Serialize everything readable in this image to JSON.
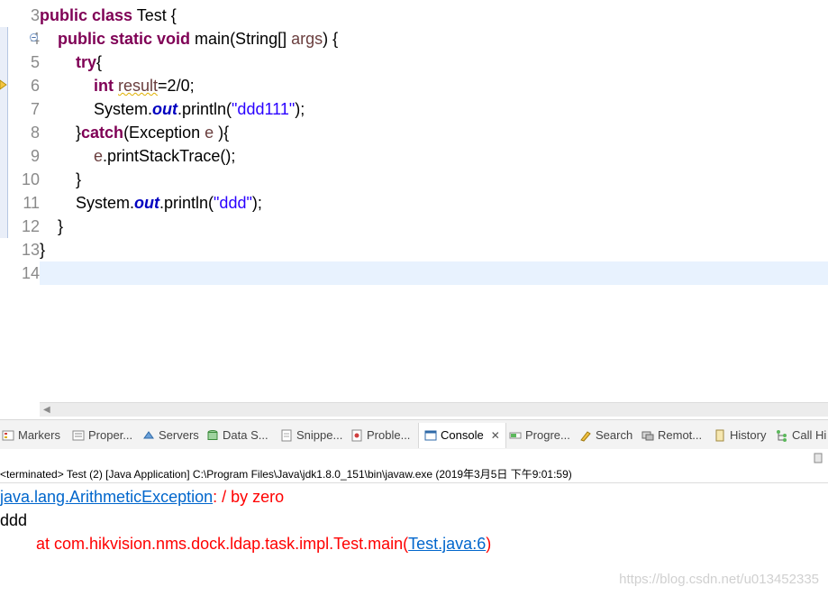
{
  "editor": {
    "line_numbers": [
      "3",
      "4",
      "5",
      "6",
      "7",
      "8",
      "9",
      "10",
      "11",
      "12",
      "13",
      "14"
    ],
    "lines": {
      "l3": {
        "kw1": "public class",
        "rest": " Test {"
      },
      "l4": {
        "indent": "    ",
        "kw1": "public static void",
        "m": " main(String[] ",
        "param": "args",
        "rest": ") {"
      },
      "l5": {
        "indent": "        ",
        "kw1": "try",
        "rest": "{"
      },
      "l6": {
        "indent": "            ",
        "kw1": "int",
        "sp": " ",
        "var": "result",
        "rest": "=2/0;"
      },
      "l7": {
        "indent": "            ",
        "a": "System.",
        "field": "out",
        "b": ".println(",
        "str": "\"ddd111\"",
        "c": ");"
      },
      "l8": {
        "indent": "        ",
        "a": "}",
        "kw1": "catch",
        "b": "(Exception ",
        "var": "e",
        "c": " ){"
      },
      "l9": {
        "indent": "            ",
        "var": "e",
        "rest": ".printStackTrace();"
      },
      "l10": {
        "indent": "        ",
        "rest": "}"
      },
      "l11": {
        "indent": "        ",
        "a": "System.",
        "field": "out",
        "b": ".println(",
        "str": "\"ddd\"",
        "c": ");"
      },
      "l12": {
        "indent": "    ",
        "rest": "}"
      },
      "l13": {
        "rest": "}"
      }
    }
  },
  "tabs": [
    {
      "label": "Markers"
    },
    {
      "label": "Proper..."
    },
    {
      "label": "Servers"
    },
    {
      "label": "Data S..."
    },
    {
      "label": "Snippe..."
    },
    {
      "label": "Proble..."
    },
    {
      "label": "Console",
      "close": "✕"
    },
    {
      "label": "Progre..."
    },
    {
      "label": "Search"
    },
    {
      "label": "Remot..."
    },
    {
      "label": "History"
    },
    {
      "label": "Call Hi"
    }
  ],
  "console": {
    "header": "<terminated> Test (2) [Java Application] C:\\Program Files\\Java\\jdk1.8.0_151\\bin\\javaw.exe (2019年3月5日 下午9:01:59)",
    "exception_class": "java.lang.ArithmeticException",
    "exception_msg": ": / by zero",
    "stdout_line": "ddd",
    "stack_prefix": "        at com.hikvision.nms.dock.ldap.task.impl.Test.main(",
    "stack_link": "Test.java:6",
    "stack_suffix": ")"
  },
  "watermark": "https://blog.csdn.net/u013452335",
  "colors": {
    "keyword": "#7f0055",
    "string": "#2a00ff",
    "static_field": "#0000c0",
    "stderr": "#ff0000",
    "link": "#0066cc",
    "current_line": "#e8f2fe"
  }
}
